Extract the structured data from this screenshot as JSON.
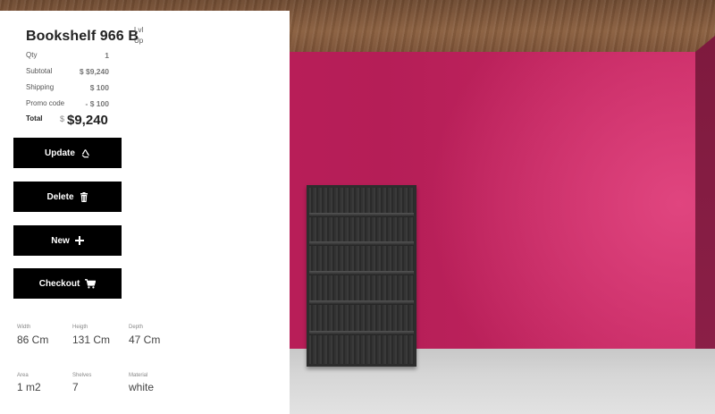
{
  "product": {
    "title": "Bookshelf 966 B",
    "side_label_line1": "Lvl",
    "side_label_line2": "Up"
  },
  "summary": {
    "qty_label": "Qty",
    "qty_value": "1",
    "subtotal_label": "Subtotal",
    "subtotal_value": "$ $9,240",
    "shipping_label": "Shipping",
    "shipping_value": "$ 100",
    "promo_label": "Promo code",
    "promo_value": "- $ 100",
    "total_label": "Total",
    "total_currency": "$",
    "total_value": "$9,240"
  },
  "actions": {
    "update_label": "Update",
    "delete_label": "Delete",
    "new_label": "New",
    "checkout_label": "Checkout"
  },
  "dimensions": {
    "width_label": "Width",
    "width_value": "86 Cm",
    "height_label": "Heigth",
    "height_value": "131 Cm",
    "depth_label": "Depth",
    "depth_value": "47 Cm",
    "area_label": "Area",
    "area_value": "1 m2",
    "shelves_label": "Shelves",
    "shelves_value": "7",
    "material_label": "Material",
    "material_value": "white"
  },
  "icons": {
    "update": "recycle-icon",
    "delete": "trash-icon",
    "new": "plus-icon",
    "checkout": "cart-icon"
  },
  "colors": {
    "wall": "#c01f5c",
    "button": "#000000",
    "panel": "#ffffff"
  }
}
